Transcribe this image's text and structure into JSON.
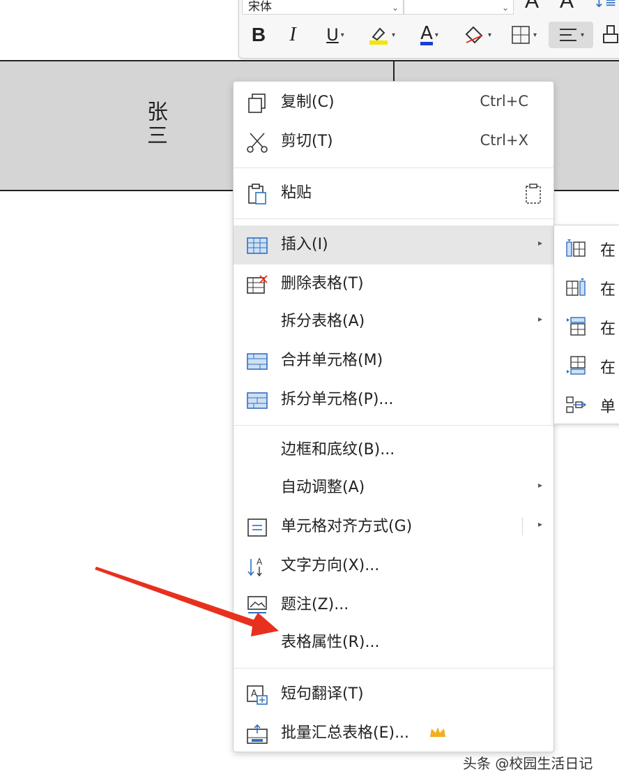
{
  "toolbar": {
    "font_name": "宋体",
    "font_size": "",
    "grow_label": "A",
    "shrink_label": "A",
    "bold_label": "B",
    "italic_label": "I",
    "underline_label": "U",
    "font_color_label": "A",
    "highlight_color": "#f2e600",
    "font_color": "#1a3cd6"
  },
  "document": {
    "cell_text": "张三"
  },
  "context_menu": {
    "copy": {
      "label": "复制(C)",
      "shortcut": "Ctrl+C"
    },
    "cut": {
      "label": "剪切(T)",
      "shortcut": "Ctrl+X"
    },
    "paste": {
      "label": "粘贴"
    },
    "insert": {
      "label": "插入(I)"
    },
    "delete_table": {
      "label": "删除表格(T)"
    },
    "split_table": {
      "label": "拆分表格(A)"
    },
    "merge_cells": {
      "label": "合并单元格(M)"
    },
    "split_cells": {
      "label": "拆分单元格(P)..."
    },
    "borders": {
      "label": "边框和底纹(B)..."
    },
    "autofit": {
      "label": "自动调整(A)"
    },
    "cell_align": {
      "label": "单元格对齐方式(G)"
    },
    "text_direction": {
      "label": "文字方向(X)..."
    },
    "caption": {
      "label": "题注(Z)..."
    },
    "table_props": {
      "label": "表格属性(R)..."
    },
    "translate": {
      "label": "短句翻译(T)"
    },
    "batch_summary": {
      "label": "批量汇总表格(E)..."
    }
  },
  "submenu": {
    "items": [
      "在",
      "在",
      "在",
      "在",
      "单"
    ]
  },
  "watermark": "头条 @校园生活日记",
  "colors": {
    "accent_blue": "#2f6fc0",
    "highlight_bg": "#e6e6e6",
    "arrow_red": "#e8301e",
    "crown": "#f0b020"
  }
}
